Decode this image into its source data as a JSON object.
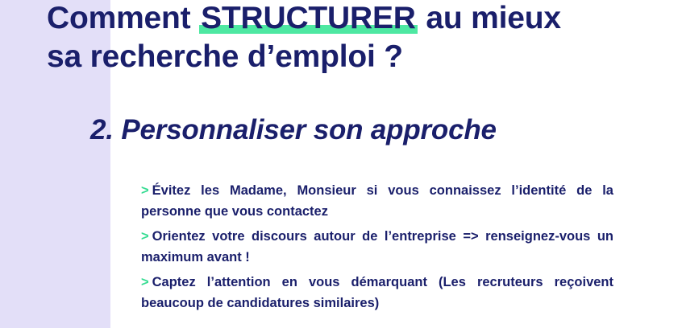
{
  "title": {
    "part1": "Comment ",
    "highlight": "STRUCTURER",
    "part2": " au mieux",
    "line2": "sa recherche d’emploi ?"
  },
  "subtitle": "2. Personnaliser son approche",
  "bullet_marker": ">",
  "bullets": [
    "Évitez les Madame, Monsieur si vous connaissez l’identité de la personne que vous contactez",
    "Orientez votre discours autour de l’entreprise => renseignez-vous un maximum avant !",
    "Captez l’attention en vous démarquant (Les recruteurs reçoivent beaucoup de candidatures similaires)"
  ],
  "colors": {
    "text": "#1a1f6b",
    "accent_green": "#4ee8a2",
    "left_band": "#e3dff8"
  }
}
